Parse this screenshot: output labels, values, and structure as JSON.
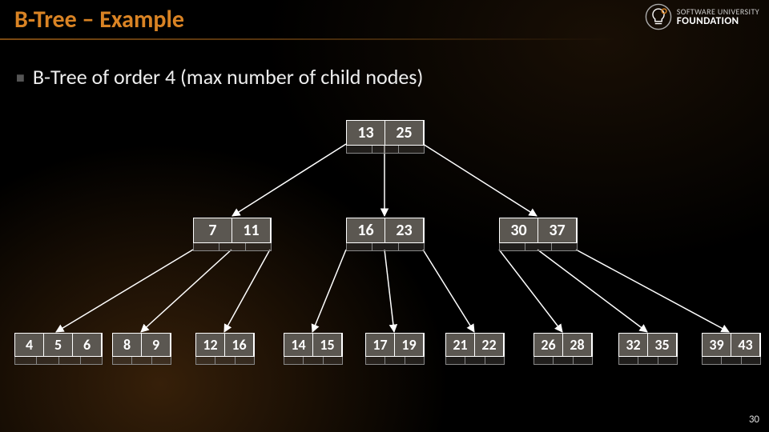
{
  "title": "B-Tree – Example",
  "logo": {
    "line1": "SOFTWARE UNIVERSITY",
    "line2": "FOUNDATION"
  },
  "bullet": "B-Tree of order 4 (max number of child nodes)",
  "page_number": "30",
  "btree": {
    "root": {
      "keys": [
        "13",
        "25"
      ]
    },
    "level1": [
      {
        "keys": [
          "7",
          "11"
        ]
      },
      {
        "keys": [
          "16",
          "23"
        ]
      },
      {
        "keys": [
          "30",
          "37"
        ]
      }
    ],
    "leaves": [
      {
        "keys": [
          "4",
          "5",
          "6"
        ]
      },
      {
        "keys": [
          "8",
          "9"
        ]
      },
      {
        "keys": [
          "12",
          "16"
        ]
      },
      {
        "keys": [
          "14",
          "15"
        ]
      },
      {
        "keys": [
          "17",
          "19"
        ]
      },
      {
        "keys": [
          "21",
          "22"
        ]
      },
      {
        "keys": [
          "26",
          "28"
        ]
      },
      {
        "keys": [
          "32",
          "35"
        ]
      },
      {
        "keys": [
          "39",
          "43"
        ]
      }
    ]
  }
}
